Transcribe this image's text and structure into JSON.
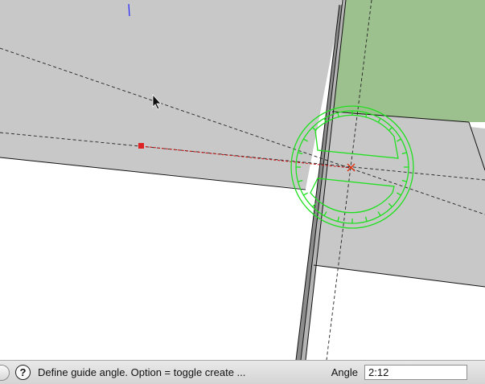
{
  "statusbar": {
    "message": "Define guide angle.  Option = toggle create ...",
    "vcb_label": "Angle",
    "vcb_value": "2:12"
  },
  "icons": {
    "help": "?"
  },
  "colors": {
    "face_gray": "#c8c8c8",
    "face_green": "#9dc18e",
    "protractor": "#1fe01f",
    "guide_red": "#cc1111"
  }
}
